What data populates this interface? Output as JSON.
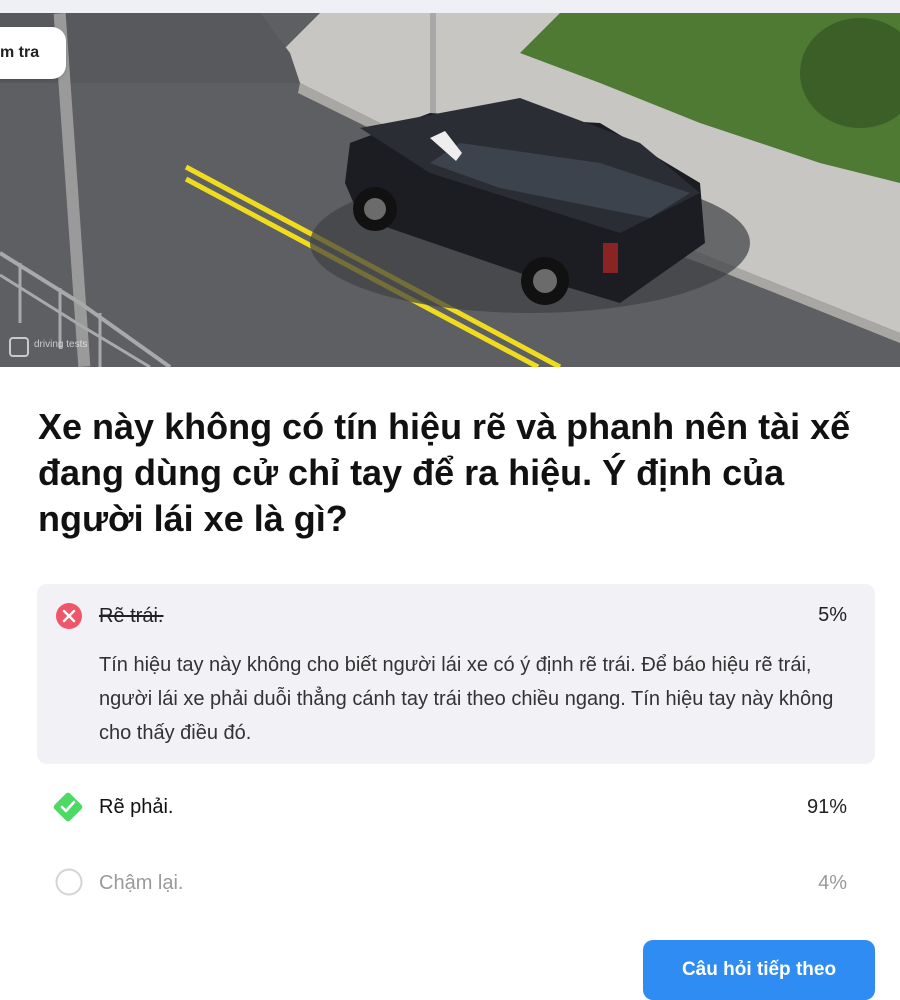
{
  "image_tag": "m tra",
  "photo": {
    "watermark": "driving tests"
  },
  "question": "Xe này không có tín hiệu rẽ và phanh nên tài xế đang dùng cử chỉ tay để ra hiệu. Ý định của người lái xe là gì?",
  "answers": [
    {
      "label": "Rẽ trái.",
      "percent": "5%",
      "state": "incorrect",
      "explanation": "Tín hiệu tay này không cho biết người lái xe có ý định rẽ trái. Để báo hiệu rẽ trái, người lái xe phải duỗi thẳng cánh tay trái theo chiều ngang. Tín hiệu tay này không cho thấy điều đó."
    },
    {
      "label": "Rẽ phải.",
      "percent": "91%",
      "state": "correct"
    },
    {
      "label": "Chậm lại.",
      "percent": "4%",
      "state": "unselected"
    }
  ],
  "next_button": "Câu hỏi tiếp theo",
  "colors": {
    "accent": "#2f8cf2",
    "incorrect": "#f0566a",
    "correct": "#4cd964",
    "panel": "#f1f1f6",
    "muted": "#9a9a9a"
  }
}
